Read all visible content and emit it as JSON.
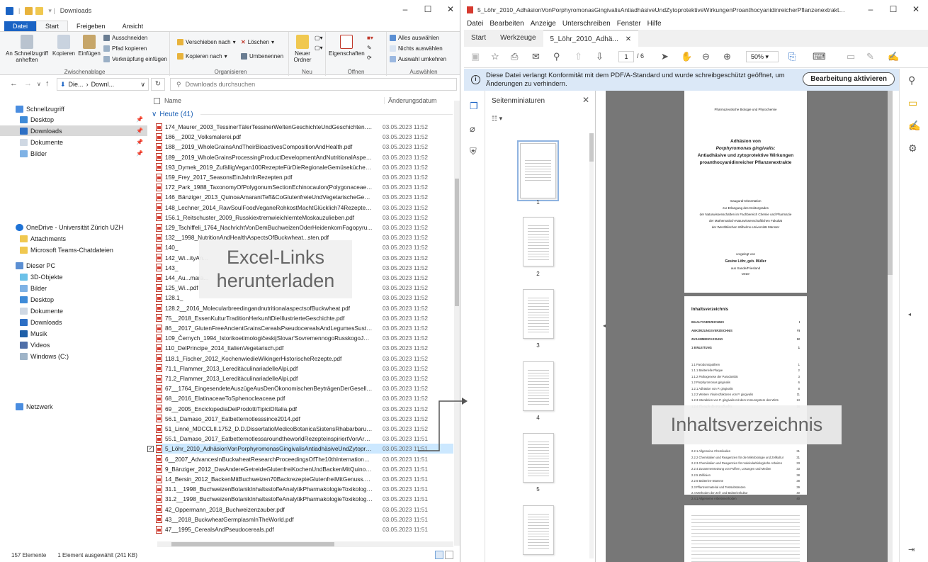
{
  "explorer": {
    "title": "Downloads",
    "tabs": [
      "Datei",
      "Start",
      "Freigeben",
      "Ansicht"
    ],
    "ribbon": {
      "pin_quick_access": "An Schnellzugriff anheften",
      "copy": "Kopieren",
      "paste": "Einfügen",
      "cut": "Ausschneiden",
      "copy_path": "Pfad kopieren",
      "paste_shortcut": "Verknüpfung einfügen",
      "group_clipboard": "Zwischenablage",
      "move_to": "Verschieben nach",
      "copy_to": "Kopieren nach",
      "delete": "Löschen",
      "rename": "Umbenennen",
      "group_organize": "Organisieren",
      "new_folder": "Neuer Ordner",
      "group_new": "Neu",
      "properties": "Eigenschaften",
      "group_open": "Öffnen",
      "select_all": "Alles auswählen",
      "select_none": "Nichts auswählen",
      "invert_selection": "Auswahl umkehren",
      "group_select": "Auswählen"
    },
    "address": {
      "path_part1": "Die...",
      "path_part2": "Downl...",
      "search_placeholder": "Downloads durchsuchen"
    },
    "nav": {
      "quick_access": "Schnellzugriff",
      "quick_items": [
        "Desktop",
        "Downloads",
        "Dokumente",
        "Bilder"
      ],
      "onedrive": "OneDrive - Universität Zürich UZH",
      "onedrive_items": [
        "Attachments",
        "Microsoft Teams-Chatdateien"
      ],
      "this_pc": "Dieser PC",
      "pc_items": [
        "3D-Objekte",
        "Bilder",
        "Desktop",
        "Dokumente",
        "Downloads",
        "Musik",
        "Videos",
        "Windows (C:)"
      ],
      "network": "Netzwerk"
    },
    "columns": {
      "name": "Name",
      "date": "Änderungsdatum"
    },
    "group_header": "Heute (41)",
    "files": [
      {
        "name": "174_Maurer_2003_TessinerTälerTessinerWeltenGeschichteUndGeschichten.pdf",
        "date": "03.05.2023 11:52"
      },
      {
        "name": "186__2002_Volksmalerei.pdf",
        "date": "03.05.2023 11:52"
      },
      {
        "name": "188__2019_WholeGrainsAndTheirBioactivesCompositionAndHealth.pdf",
        "date": "03.05.2023 11:52"
      },
      {
        "name": "189__2019_WholeGrainsProcessingProductDevelopmentAndNutritionalAspect...",
        "date": "03.05.2023 11:52"
      },
      {
        "name": "193_Dymek_2019_ZufälligVegan100RezepteFürDieRegionaleGemüseküche­Nic...",
        "date": "03.05.2023 11:52"
      },
      {
        "name": "159_Frey_2017_SeasonsEinJahrInRezepten.pdf",
        "date": "03.05.2023 11:52"
      },
      {
        "name": "172_Park_1988_TaxonomyOfPolygonumSectionEchinocaulon(Polygonaceae)....",
        "date": "03.05.2023 11:52"
      },
      {
        "name": "146_Bänziger_2013_QuinoaAmarantTeff&CoGlutenfreieUndVegetarischeGenus...",
        "date": "03.05.2023 11:52"
      },
      {
        "name": "148_Lechner_2014_RawSoulFoodVeganeRohkostMachtGlücklich74RezepteVon...",
        "date": "03.05.2023 11:52"
      },
      {
        "name": "156.1_Reitschuster_2009_RusskiextremwieichlernteMoskauzulieben.pdf",
        "date": "03.05.2023 11:52"
      },
      {
        "name": "129_Tschiffeli_1764_NachrichtVonDemBuchweizenOderHeidenkornFagopyru...",
        "date": "03.05.2023 11:52"
      },
      {
        "name": "132__1998_NutritionAndHealthAspectsOfBuckwheat...sten.pdf",
        "date": "03.05.2023 11:52"
      },
      {
        "name": "140_",
        "date": "03.05.2023 11:52"
      },
      {
        "name": "142_Wi...ityAn...",
        "date": "03.05.2023 11:52"
      },
      {
        "name": "143_",
        "date": "03.05.2023 11:52"
      },
      {
        "name": "144_Au...mara...",
        "date": "03.05.2023 11:52"
      },
      {
        "name": "125_Wi...pdf",
        "date": "03.05.2023 11:52"
      },
      {
        "name": "128.1_",
        "date": "03.05.2023 11:52"
      },
      {
        "name": "128.2__2016_MolecularbreedingandnutritionalaspectsofBuckwheat.pdf",
        "date": "03.05.2023 11:52"
      },
      {
        "name": "75__2018_EssenKulturTraditionHerkunftDieIllustrierteGeschichte.pdf",
        "date": "03.05.2023 11:52"
      },
      {
        "name": "86__2017_GlutenFreeAncientGrainsCerealsPseudocerealsAndLegumesSustaina...",
        "date": "03.05.2023 11:52"
      },
      {
        "name": "109_Černych_1994_IstorikoetimologičeskijSlovar'SovremennogoRusskogoJazy...",
        "date": "03.05.2023 11:52"
      },
      {
        "name": "110_DelPrincipe_2014_ItalienVegetarisch.pdf",
        "date": "03.05.2023 11:52"
      },
      {
        "name": "118.1_Fischer_2012_KochenwiedieWikingerHistorischeRezepte.pdf",
        "date": "03.05.2023 11:52"
      },
      {
        "name": "71.1_Flammer_2013_LereditàculinariadelleAlpi.pdf",
        "date": "03.05.2023 11:52"
      },
      {
        "name": "71.2_Flammer_2013_LereditàculinariadelleAlpi.pdf",
        "date": "03.05.2023 11:52"
      },
      {
        "name": "67__1764_EingesendeteAuszügeAusDenÖkonomischenBeyträgenDerGesellsch...",
        "date": "03.05.2023 11:52"
      },
      {
        "name": "68__2016_ElatinaceaeToSphenocleaceae.pdf",
        "date": "03.05.2023 11:52"
      },
      {
        "name": "69__2005_EnciclopediaDeiProdottiTipiciDItalia.pdf",
        "date": "03.05.2023 11:52"
      },
      {
        "name": "56.1_Damaso_2017_Eatbetternotlesssince2014.pdf",
        "date": "03.05.2023 11:52"
      },
      {
        "name": "51_Linné_MDCCLII.1752_D.D.DissertatioMedicoBotanicaSistensRhabarbarumQ...",
        "date": "03.05.2023 11:52"
      },
      {
        "name": "55.1_Damaso_2017_EatbetternotlessaroundtheworldRezepteinspiriertVonArom...",
        "date": "03.05.2023 11:51"
      },
      {
        "name": "5_Löhr_2010_AdhäsionVonPorphyromonasGingivalisAntiadhäsiveUndZytopro...",
        "date": "03.05.2023 11:51"
      },
      {
        "name": "6__2007_AdvancesInBuckwheatResearchProceedingsOfThe10thInternationalSy...",
        "date": "03.05.2023 11:51"
      },
      {
        "name": "9_Bänziger_2012_DasAndereGetreideGlutenfreiKochenUndBackenMitQuinoaA...",
        "date": "03.05.2023 11:51"
      },
      {
        "name": "14_Bersin_2012_BackenMitBuchweizen70BackrezepteGlutenfreiMitGenuss.pdf",
        "date": "03.05.2023 11:51"
      },
      {
        "name": "31.1__1998_BuchweizenBotanikInhaltsstoffeAnalytikPharmakologieToxikologi...",
        "date": "03.05.2023 11:51"
      },
      {
        "name": "31.2__1998_BuchweizenBotanikInhaltsstoffeAnalytikPharmakologieToxikologi...",
        "date": "03.05.2023 11:51"
      },
      {
        "name": "42_Oppermann_2018_Buchweizenzauber.pdf",
        "date": "03.05.2023 11:51"
      },
      {
        "name": "43__2018_BuckwheatGermplasmInTheWorld.pdf",
        "date": "03.05.2023 11:51"
      },
      {
        "name": "47__1995_CerealsAndPseudocereals.pdf",
        "date": "03.05.2023 11:51"
      }
    ],
    "status": {
      "count": "157 Elemente",
      "selected": "1 Element ausgewählt (241 KB)"
    }
  },
  "acrobat": {
    "title": "5_Löhr_2010_AdhäsionVonPorphyromonasGingivalisAntiadhäsiveUndZytoprotektiveWirkungenProanthocyanidinreicherPflanzenextrakte.pdf - Adob...",
    "menu": [
      "Datei",
      "Bearbeiten",
      "Anzeige",
      "Unterschreiben",
      "Fenster",
      "Hilfe"
    ],
    "tabs": {
      "home": "Start",
      "tools": "Werkzeuge",
      "doc": "5_Löhr_2010_Adhä..."
    },
    "page_current": "1",
    "page_total": "/ 6",
    "zoom": "50%",
    "notice": "Diese Datei verlangt Konformität mit dem PDF/A-Standard und wurde schreibgeschützt geöffnet, um Änderungen zu verhindern.",
    "edit_button": "Bearbeitung aktivieren",
    "thumbs_title": "Seitenminiaturen",
    "thumb_numbers": [
      "1",
      "2",
      "3",
      "4",
      "5"
    ],
    "page1": {
      "institute": "Pharmazeutische Biologie und Phytochemie",
      "title1": "Adhäsion von",
      "title2": "Porphyromonas gingivalis:",
      "title3": "Antiadhäsive und zytoprotektive Wirkungen",
      "title4": "proanthocyanidinreicher Pflanzenextrakte",
      "sub1": "Inaugural-Dissertation",
      "sub2": "zur Erlangung des Doktorgrades",
      "sub3": "der Naturwissenschaften im Fachbereich Chemie und Pharmazie",
      "sub4": "der Mathematisch-Naturwissenschaftlichen Fakultät",
      "sub5": "der Westfälischen Wilhelms-Universität Münster",
      "by": "vorgelegt von",
      "author": "Gesine Löhr, geb. Müller",
      "from": "aus Sande/Friesland",
      "year": "-2010-"
    },
    "page2": {
      "heading": "Inhaltsverzeichnis",
      "toc": [
        {
          "t": "INHALTSVERZEICHNIS",
          "p": "I",
          "b": true
        },
        {
          "t": "ABKÜRZUNGSVERZEICHNIS",
          "p": "VI",
          "b": true
        },
        {
          "t": "ZUSAMMENFASSUNG",
          "p": "IX",
          "b": true
        },
        {
          "t": "1  EINLEITUNG",
          "p": "1",
          "b": true
        },
        {
          "t": "1.1  Parodontopathien",
          "p": "1",
          "b": false
        },
        {
          "t": "1.1.1  Bakterielle Plaque",
          "p": "2",
          "b": false
        },
        {
          "t": "1.1.2  Pathogenese der Parodontitis",
          "p": "3",
          "b": false
        },
        {
          "t": "1.2  Porphyromonas gingivalis",
          "p": "6",
          "b": false
        },
        {
          "t": "1.2.1  Adhäsion von P. gingivalis",
          "p": "8",
          "b": false
        },
        {
          "t": "1.2.2  Weitere Virulenzfaktoren von P. gingivalis",
          "p": "11",
          "b": false
        },
        {
          "t": "1.2.3  Interaktion von P. gingivalis mit dem Immunsystem des Wirts",
          "p": "13",
          "b": false
        },
        {
          "t": "1.2.4  Therapie der Parodontitis",
          "p": "16",
          "b": false
        },
        {
          "t": "2.2.1  Allgemeine Chemikalien",
          "p": "31",
          "b": false
        },
        {
          "t": "2.2.2  Chemikalien und Reagenzien für die Mikrobiologie und Zellkultur",
          "p": "31",
          "b": false
        },
        {
          "t": "2.2.3  Chemikalien und Reagenzien für molekularbiologische Arbeiten",
          "p": "33",
          "b": false
        },
        {
          "t": "2.2.4  Zusammensetzung von Puffern, Lösungen und Medien",
          "p": "33",
          "b": false
        },
        {
          "t": "2.2.5  Zelllinien",
          "p": "38",
          "b": false
        },
        {
          "t": "2.2.6  Bakterien-Stämme",
          "p": "38",
          "b": false
        },
        {
          "t": "2.3  Pflanzenmaterial und Testsubstanzen",
          "p": "39",
          "b": false
        },
        {
          "t": "2.4  Methoden der Zell- und Bakterienkultur",
          "p": "40",
          "b": false
        },
        {
          "t": "2.4.1  Allgemeine Arbeitsmethoden",
          "p": "40",
          "b": false
        }
      ]
    }
  },
  "overlays": {
    "excel_line1": "Excel-Links",
    "excel_line2": "herunterladen",
    "toc_label": "Inhaltsverzeichnis"
  },
  "colors": {
    "accent": "#1a63c4",
    "selection": "#cce8ff",
    "notice_bg": "#dbe8f7",
    "pdf_red": "#d63a2f"
  }
}
